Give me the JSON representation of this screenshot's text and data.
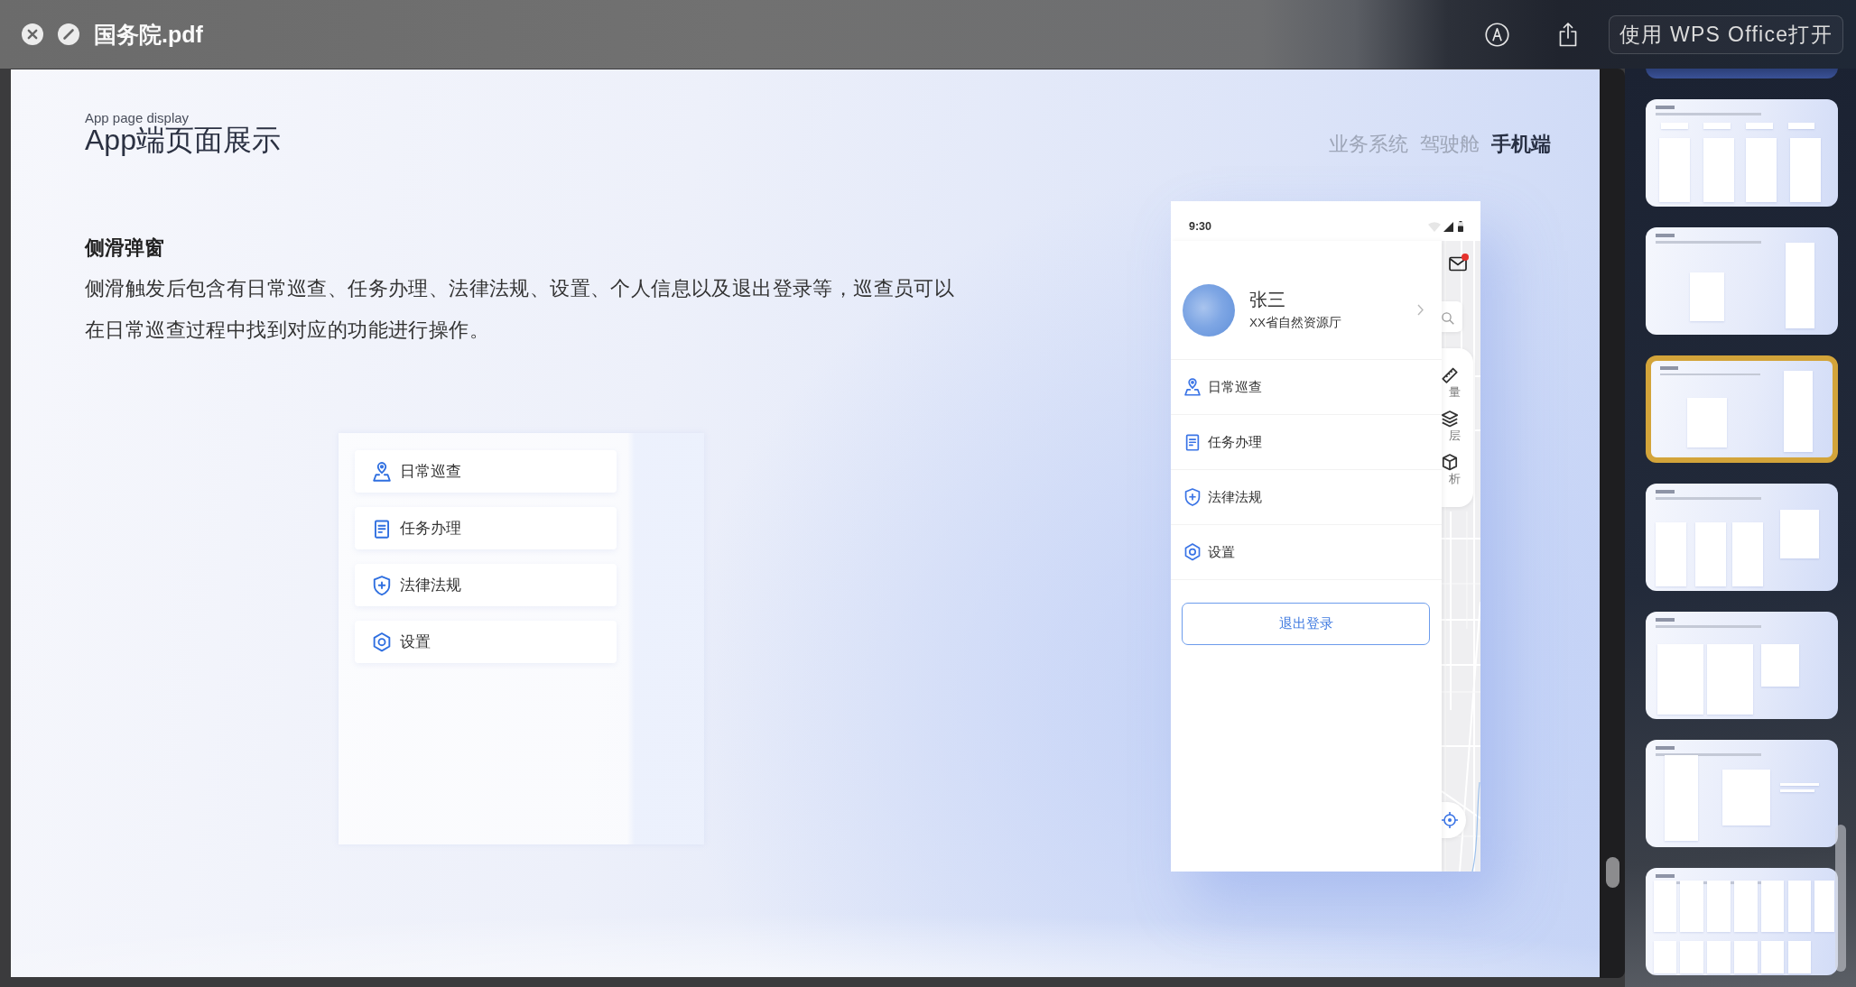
{
  "window": {
    "title": "国务院.pdf",
    "open_with_button": "使用 WPS Office打开"
  },
  "slide": {
    "subtitle": "App page display",
    "title": "App端页面展示",
    "tabs": [
      {
        "label": "业务系统",
        "selected": false
      },
      {
        "label": "驾驶舱",
        "selected": false
      },
      {
        "label": "手机端",
        "selected": true
      }
    ],
    "section_heading": "侧滑弹窗",
    "description": "侧滑触发后包含有日常巡查、任务办理、法律法规、设置、个人信息以及退出登录等，巡查员可以在日常巡查过程中找到对应的功能进行操作。",
    "menu_preview": [
      {
        "label": "日常巡查",
        "kind": "patrol"
      },
      {
        "label": "任务办理",
        "kind": "task"
      },
      {
        "label": "法律法规",
        "kind": "law"
      },
      {
        "label": "设置",
        "kind": "settings"
      }
    ],
    "phone": {
      "time": "9:30",
      "user": {
        "name": "张三",
        "org": "XX省自然资源厅"
      },
      "menu": [
        {
          "label": "日常巡查",
          "kind": "patrol"
        },
        {
          "label": "任务办理",
          "kind": "task"
        },
        {
          "label": "法律法规",
          "kind": "law"
        },
        {
          "label": "设置",
          "kind": "settings"
        }
      ],
      "logout_button": "退出登录",
      "unread_mail": true,
      "map_tools": [
        {
          "label": "量",
          "kind": "measure"
        },
        {
          "label": "层",
          "kind": "layer"
        },
        {
          "label": "析",
          "kind": "analysis"
        }
      ]
    }
  },
  "thumbnails": [
    {
      "selected": false
    },
    {
      "selected": false
    },
    {
      "selected": false
    },
    {
      "selected": true
    },
    {
      "selected": false
    },
    {
      "selected": false
    },
    {
      "selected": false
    },
    {
      "selected": false
    }
  ]
}
